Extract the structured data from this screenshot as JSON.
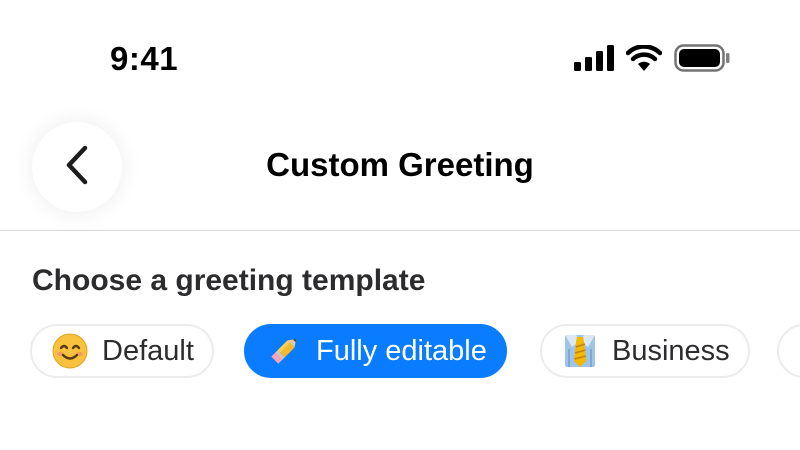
{
  "status_bar": {
    "time": "9:41",
    "icons": [
      "signal-icon",
      "wifi-icon",
      "battery-icon"
    ]
  },
  "nav": {
    "title": "Custom Greeting",
    "back_icon": "chevron-left-icon"
  },
  "content": {
    "section_label": "Choose a greeting template",
    "templates": [
      {
        "label": "Default",
        "icon": "smiling-face-emoji",
        "selected": false
      },
      {
        "label": "Fully editable",
        "icon": "pencil-emoji",
        "selected": true
      },
      {
        "label": "Business",
        "icon": "necktie-emoji",
        "selected": false
      }
    ]
  },
  "colors": {
    "accent": "#0a7cff",
    "chip_border": "#ececef",
    "divider": "#d6d6d8"
  }
}
